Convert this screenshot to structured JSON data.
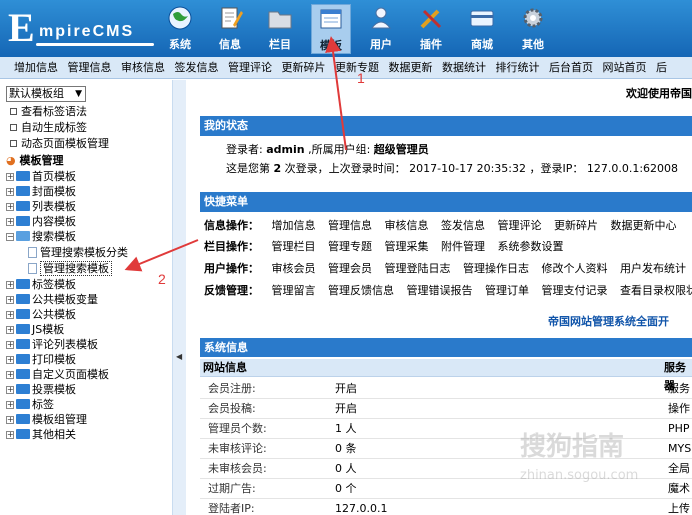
{
  "header": {
    "logo_initial": "E",
    "logo_rest": "mpireCMS",
    "nav": [
      {
        "label": "系统",
        "icon": "globe-icon"
      },
      {
        "label": "信息",
        "icon": "document-edit-icon"
      },
      {
        "label": "栏目",
        "icon": "folder-icon"
      },
      {
        "label": "模板",
        "icon": "template-window-icon"
      },
      {
        "label": "用户",
        "icon": "user-icon"
      },
      {
        "label": "插件",
        "icon": "tools-icon"
      },
      {
        "label": "商城",
        "icon": "card-icon"
      },
      {
        "label": "其他",
        "icon": "gear-icon"
      }
    ]
  },
  "submenu": [
    "增加信息",
    "管理信息",
    "审核信息",
    "签发信息",
    "管理评论",
    "更新碎片",
    "更新专题",
    "数据更新",
    "数据统计",
    "排行统计",
    "后台首页",
    "网站首页",
    "后"
  ],
  "sidebar": {
    "template_group_select": "默认模板组",
    "top_links": [
      "查看标签语法",
      "自动生成标签",
      "动态页面模板管理"
    ],
    "root": "模板管理",
    "items": [
      "首页模板",
      "封面模板",
      "列表模板",
      "内容模板",
      "搜索模板"
    ],
    "search_children": [
      "管理搜索模板分类",
      "管理搜索模板"
    ],
    "items_after": [
      "标签模板",
      "公共模板变量",
      "公共模板",
      "JS模板",
      "评论列表模板",
      "打印模板",
      "自定义页面模板",
      "投票模板",
      "标签",
      "模板组管理",
      "其他相关"
    ]
  },
  "main": {
    "welcome": "欢迎使用帝国",
    "status": {
      "title": "我的状态",
      "login_label": "登录者:",
      "user": "admin",
      "group_label": ",所属用户组:",
      "group": "超级管理员",
      "visit_prefix": "这是您第",
      "visit_count": "2",
      "visit_suffix": "次登录，上次登录时间：",
      "last_time": "2017-10-17 20:35:32",
      "ip_label": "，登录IP：",
      "ip": "127.0.0.1:62008"
    },
    "quick": {
      "title": "快捷菜单",
      "rows": [
        {
          "label": "信息操作：",
          "links": [
            "增加信息",
            "管理信息",
            "审核信息",
            "签发信息",
            "管理评论",
            "更新碎片",
            "数据更新中心"
          ]
        },
        {
          "label": "栏目操作：",
          "links": [
            "管理栏目",
            "管理专题",
            "管理采集",
            "附件管理",
            "系统参数设置"
          ]
        },
        {
          "label": "用户操作：",
          "links": [
            "审核会员",
            "管理会员",
            "管理登陆日志",
            "管理操作日志",
            "修改个人资料",
            "用户发布统计"
          ]
        },
        {
          "label": "反馈管理：",
          "links": [
            "管理留言",
            "管理反馈信息",
            "管理错误报告",
            "管理订单",
            "管理支付记录",
            "查看目录权限状"
          ]
        }
      ]
    },
    "banner": "帝国网站管理系统全面开",
    "sysinfo": {
      "title": "系统信息",
      "site_col": "网站信息",
      "server_col": "服务器",
      "rows": [
        {
          "k": "会员注册:",
          "v": "开启",
          "r": "服务"
        },
        {
          "k": "会员投稿:",
          "v": "开启",
          "r": "操作"
        },
        {
          "k": "管理员个数:",
          "v": "1 人",
          "r": "PHP"
        },
        {
          "k": "未审核评论:",
          "v": "0 条",
          "r": "MYS"
        },
        {
          "k": "未审核会员:",
          "v": "0 人",
          "r": "全局"
        },
        {
          "k": "过期广告:",
          "v": "0 个",
          "r": "魔术"
        },
        {
          "k": "登陆者IP:",
          "v": "127.0.0.1",
          "r": "上传"
        }
      ]
    }
  },
  "annotations": {
    "arrow1": "1",
    "arrow2": "2"
  },
  "watermark": {
    "main": "搜狗指南",
    "sub": "zhinan.sogou.com"
  },
  "colors": {
    "header_blue": "#1f7bc9",
    "panel_blue": "#2a7acb",
    "arrow_red": "#e03a3a"
  }
}
